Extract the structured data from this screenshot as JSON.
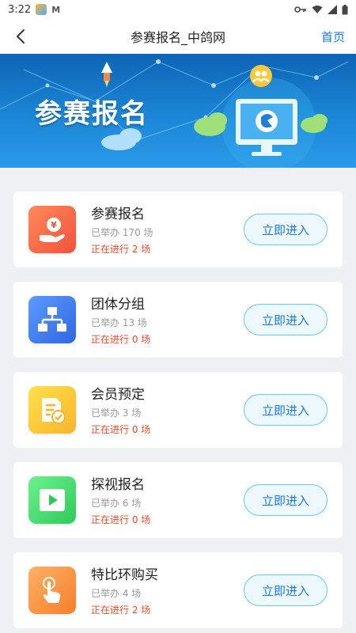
{
  "status_bar": {
    "time": "3:22",
    "mail_letter": "M",
    "icons": [
      "app-notification-icon",
      "mail-icon",
      "key-icon",
      "wifi-icon",
      "signal-icon",
      "battery-icon"
    ]
  },
  "header": {
    "title": "参赛报名_中鸽网",
    "home_label": "首页"
  },
  "banner": {
    "title": "参赛报名"
  },
  "colors": {
    "accent": "#1b78d8",
    "ongoing": "#e64a2e",
    "button_border": "#6ec6ef"
  },
  "cards": [
    {
      "title": "参赛报名",
      "held": "已举办 170 场",
      "ongoing": "正在进行 2 场",
      "button": "立即进入",
      "icon": "money-hand-icon"
    },
    {
      "title": "团体分组",
      "held": "已举办 13 场",
      "ongoing": "正在进行 0 场",
      "button": "立即进入",
      "icon": "org-chart-icon"
    },
    {
      "title": "会员预定",
      "held": "已举办 3 场",
      "ongoing": "正在进行 0 场",
      "button": "立即进入",
      "icon": "document-check-icon"
    },
    {
      "title": "探视报名",
      "held": "已举办 6 场",
      "ongoing": "正在进行 0 场",
      "button": "立即进入",
      "icon": "play-icon"
    },
    {
      "title": "特比环购买",
      "held": "已举办 4 场",
      "ongoing": "正在进行 2 场",
      "button": "立即进入",
      "icon": "touch-hand-icon"
    }
  ]
}
